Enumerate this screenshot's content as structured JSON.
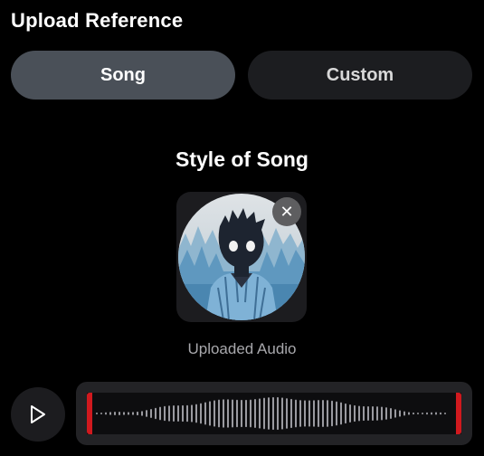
{
  "header": {
    "title": "Upload Reference"
  },
  "tabs": [
    {
      "label": "Song",
      "active": true
    },
    {
      "label": "Custom",
      "active": false
    }
  ],
  "section": {
    "title": "Style of Song"
  },
  "media": {
    "caption": "Uploaded Audio",
    "remove_icon": "close-icon",
    "play_icon": "play-icon"
  },
  "waveform": {
    "selection_start": 0.0,
    "selection_end": 1.0,
    "handle_color": "#d0191e",
    "bar_color": "#9a9aa0"
  },
  "colors": {
    "background": "#000000",
    "tab_active": "#4a5058",
    "tab_inactive": "#1c1d20"
  }
}
